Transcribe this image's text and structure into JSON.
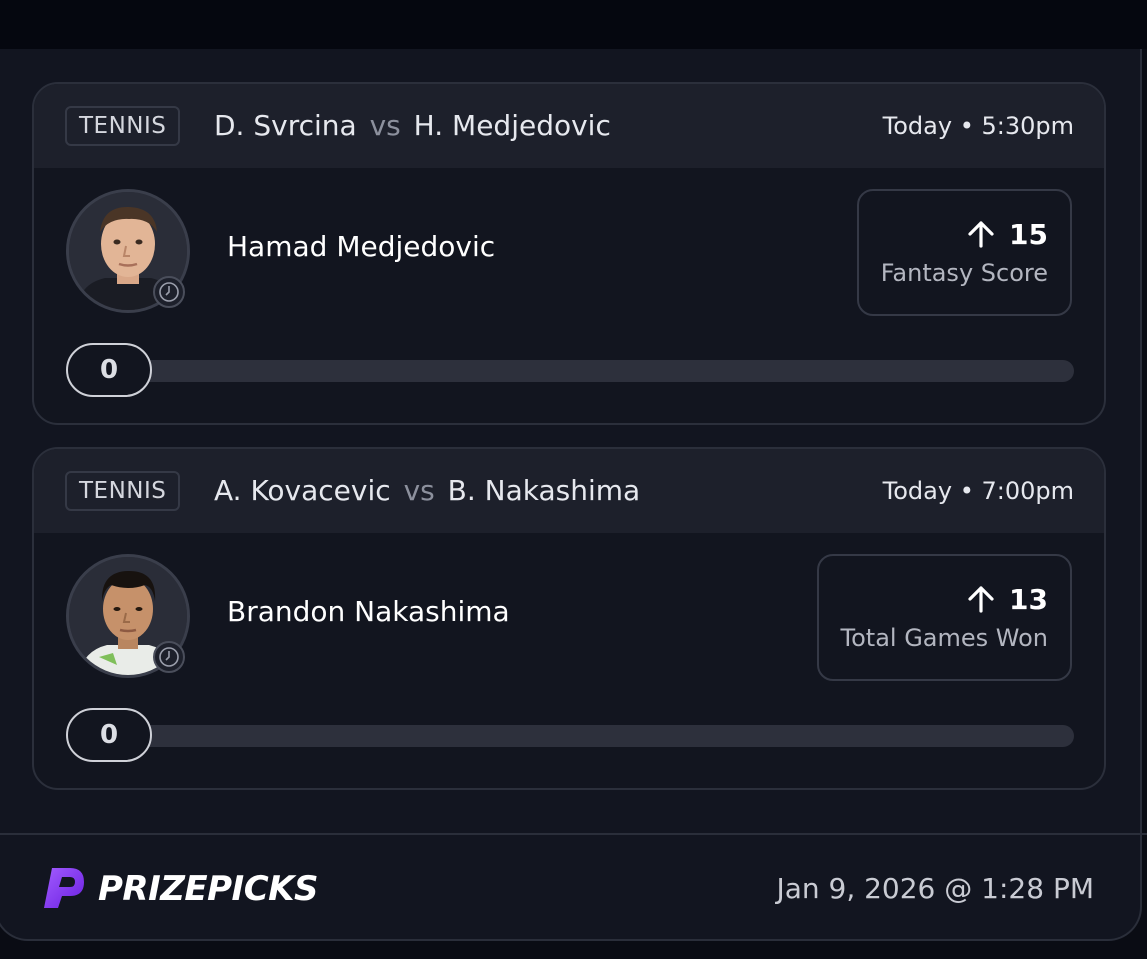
{
  "cards": [
    {
      "sport": "TENNIS",
      "player_a": "D. Svrcina",
      "vs": "vs",
      "player_b": "H. Medjedovic",
      "time": "Today • 5:30pm",
      "player_name": "Hamad Medjedovic",
      "direction_icon": "arrow-up-icon",
      "line": "15",
      "stat": "Fantasy Score",
      "current": "0"
    },
    {
      "sport": "TENNIS",
      "player_a": "A. Kovacevic",
      "vs": "vs",
      "player_b": "B. Nakashima",
      "time": "Today • 7:00pm",
      "player_name": "Brandon Nakashima",
      "direction_icon": "arrow-up-icon",
      "line": "13",
      "stat": "Total Games Won",
      "current": "0"
    }
  ],
  "footer": {
    "brand": "PRIZEPICKS",
    "timestamp": "Jan 9, 2026 @ 1:28 PM"
  },
  "colors": {
    "background": "#121520",
    "header": "#1d202b",
    "brand_purple": "#8a3ffc"
  }
}
